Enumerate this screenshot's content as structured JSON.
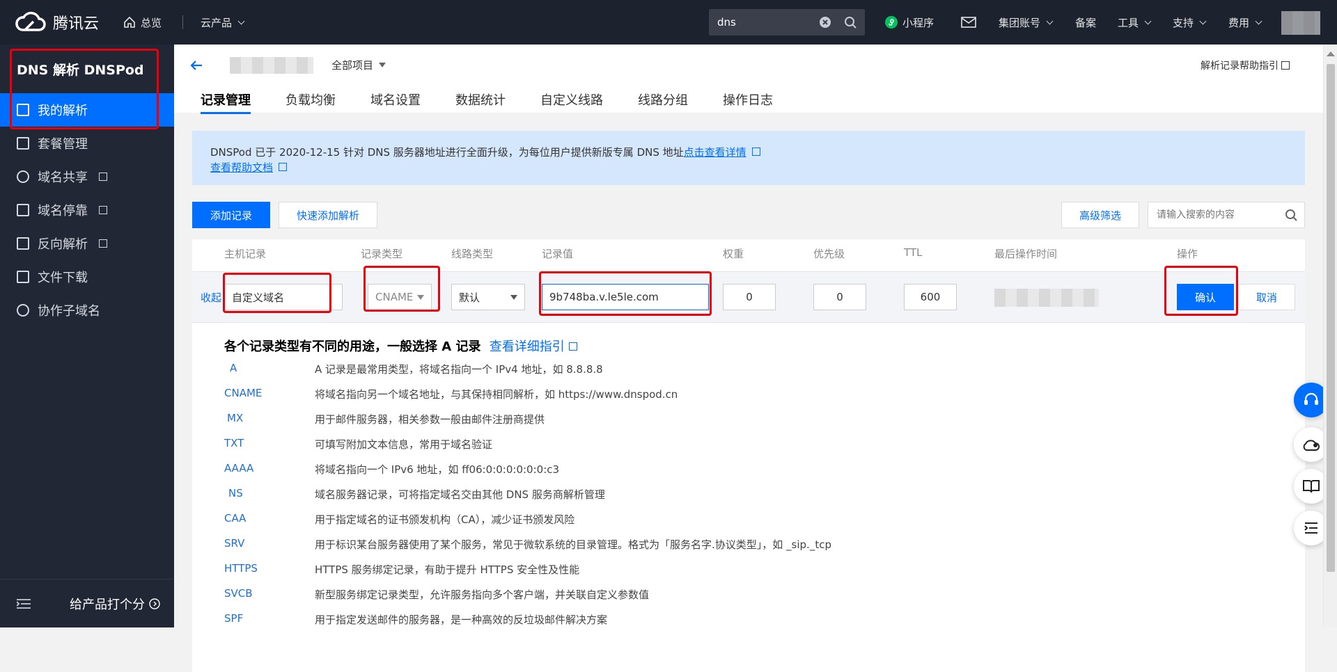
{
  "topbar": {
    "brand": "腾讯云",
    "overview": "总览",
    "products": "云产品",
    "search_value": "dns",
    "miniprogram": "小程序",
    "group_account": "集团账号",
    "icp": "备案",
    "tools": "工具",
    "support": "支持",
    "billing": "费用"
  },
  "sidebar": {
    "title": "DNS 解析 DNSPod",
    "items": [
      {
        "label": "我的解析",
        "icon": "domain-icon"
      },
      {
        "label": "套餐管理",
        "icon": "package-icon"
      },
      {
        "label": "域名共享",
        "icon": "share-icon"
      },
      {
        "label": "域名停靠",
        "icon": "park-icon"
      },
      {
        "label": "反向解析",
        "icon": "reverse-icon"
      },
      {
        "label": "文件下载",
        "icon": "download-icon"
      },
      {
        "label": "协作子域名",
        "icon": "globe-icon"
      }
    ],
    "feedback": "给产品打个分"
  },
  "header": {
    "project": "全部项目",
    "help_link": "解析记录帮助指引",
    "tabs": [
      "记录管理",
      "负载均衡",
      "域名设置",
      "数据统计",
      "自定义线路",
      "线路分组",
      "操作日志"
    ]
  },
  "notice": {
    "text": "DNSPod 已于 2020-12-15 针对 DNS 服务器地址进行全面升级，为每位用户提供新版专属 DNS 地址",
    "link1": "点击查看详情",
    "link2": "查看帮助文档"
  },
  "toolbar": {
    "add_record": "添加记录",
    "quick_add": "快速添加解析",
    "advanced_filter": "高级筛选",
    "search_placeholder": "请输入搜索的内容"
  },
  "table": {
    "headers": [
      "主机记录",
      "记录类型",
      "线路类型",
      "记录值",
      "权重",
      "优先级",
      "TTL",
      "最后操作时间",
      "操作"
    ],
    "collapse": "收起",
    "host": "自定义域名",
    "type": "CNAME",
    "line": "默认",
    "value": "9b748ba.v.le5le.com",
    "weight": "0",
    "priority": "0",
    "ttl": "600",
    "confirm": "确认",
    "cancel": "取消"
  },
  "guide": {
    "title": "各个记录类型有不同的用途，一般选择 A 记录",
    "link": "查看详细指引",
    "types": [
      {
        "type": "A",
        "desc": "A 记录是最常用类型，将域名指向一个 IPv4 地址，如 8.8.8.8"
      },
      {
        "type": "CNAME",
        "desc": "将域名指向另一个域名地址，与其保持相同解析，如 https://www.dnspod.cn"
      },
      {
        "type": "MX",
        "desc": "用于邮件服务器，相关参数一般由邮件注册商提供"
      },
      {
        "type": "TXT",
        "desc": "可填写附加文本信息，常用于域名验证"
      },
      {
        "type": "AAAA",
        "desc": "将域名指向一个 IPv6 地址，如 ff06:0:0:0:0:0:0:c3"
      },
      {
        "type": "NS",
        "desc": "域名服务器记录，可将指定域名交由其他 DNS 服务商解析管理"
      },
      {
        "type": "CAA",
        "desc": "用于指定域名的证书颁发机构（CA），减少证书颁发风险"
      },
      {
        "type": "SRV",
        "desc": "用于标识某台服务器使用了某个服务，常见于微软系统的目录管理。格式为「服务名字.协议类型」，如 _sip._tcp"
      },
      {
        "type": "HTTPS",
        "desc": "HTTPS 服务绑定记录，有助于提升 HTTPS 安全性及性能"
      },
      {
        "type": "SVCB",
        "desc": "新型服务绑定记录类型，允许服务指向多个客户端，并关联自定义参数值"
      },
      {
        "type": "SPF",
        "desc": "用于指定发送邮件的服务器，是一种高效的反垃圾邮件解决方案"
      }
    ]
  },
  "colors": {
    "accent": "#006eff",
    "highlight": "#e8000b",
    "sidebar": "#212734"
  }
}
